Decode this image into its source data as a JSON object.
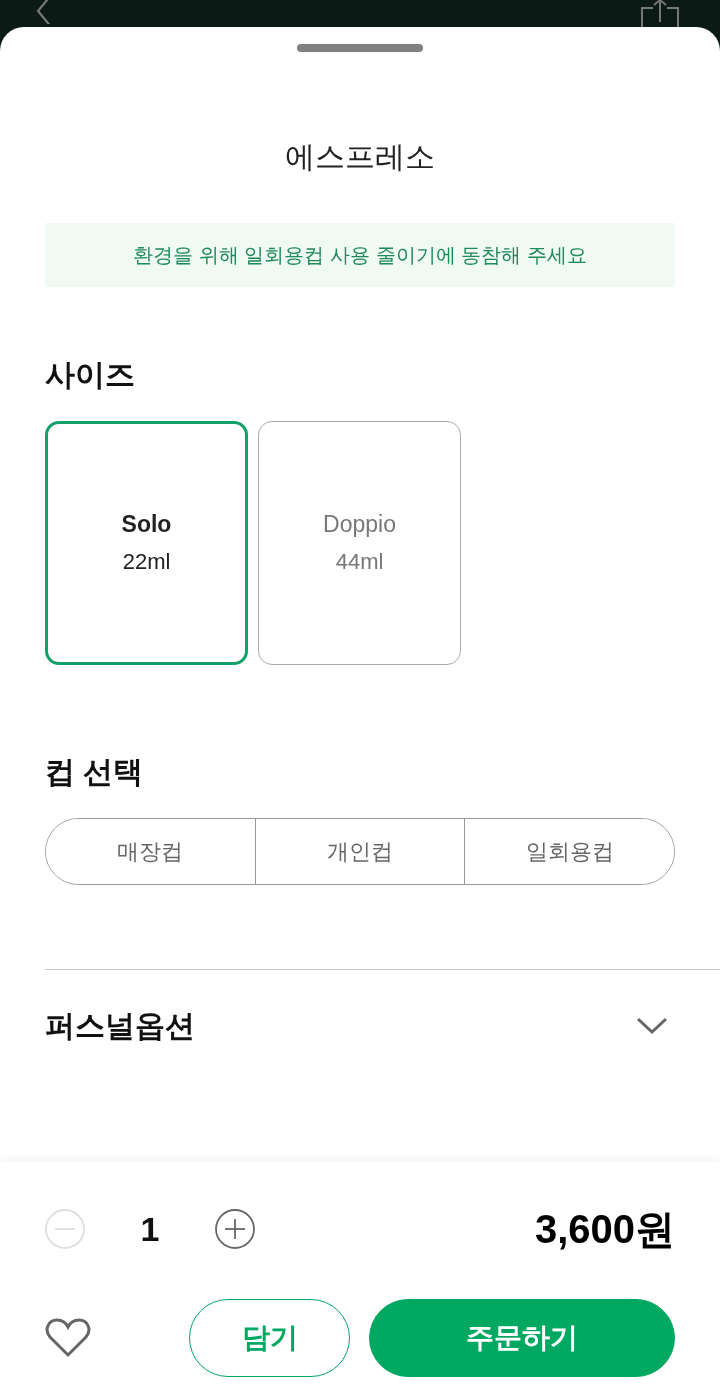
{
  "sheet": {
    "title": "에스프레소",
    "notice": "환경을 위해 일회용컵 사용 줄이기에 동참해 주세요"
  },
  "size_section": {
    "heading": "사이즈",
    "options": [
      {
        "name": "Solo",
        "volume": "22ml",
        "selected": true
      },
      {
        "name": "Doppio",
        "volume": "44ml",
        "selected": false
      }
    ]
  },
  "cup_section": {
    "heading": "컵 선택",
    "options": [
      {
        "label": "매장컵",
        "selected": false
      },
      {
        "label": "개인컵",
        "selected": false
      },
      {
        "label": "일회용컵",
        "selected": false
      }
    ]
  },
  "personal_option": {
    "heading": "퍼스널옵션",
    "expanded": false
  },
  "order_bar": {
    "quantity": "1",
    "decrease_disabled": true,
    "price": "3,600원",
    "favorite": false,
    "buttons": [
      {
        "kind": "outline",
        "label": "담기"
      },
      {
        "kind": "primary",
        "label": "주문하기"
      }
    ]
  }
}
